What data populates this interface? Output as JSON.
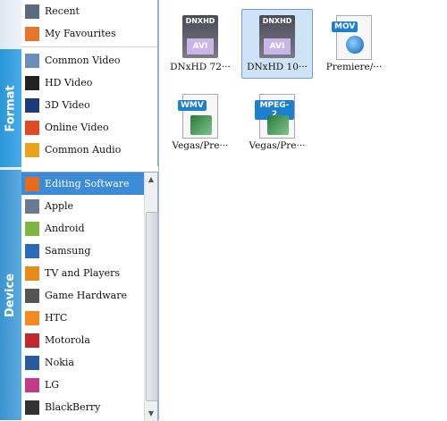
{
  "tabs": {
    "format": "Format",
    "device": "Device"
  },
  "format_list": [
    {
      "label": "Recent",
      "icon": "recent-icon",
      "color": "#5a6c80"
    },
    {
      "label": "My Favourites",
      "icon": "heart-icon",
      "color": "#e5762a"
    },
    {
      "label": "Common Video",
      "icon": "film-icon",
      "color": "#6b8fb8"
    },
    {
      "label": "HD Video",
      "icon": "hd-icon",
      "color": "#222"
    },
    {
      "label": "3D Video",
      "icon": "3d-icon",
      "color": "#1d3a7a"
    },
    {
      "label": "Online Video",
      "icon": "online-video-icon",
      "color": "#e04a20"
    },
    {
      "label": "Common Audio",
      "icon": "music-icon",
      "color": "#e6a41c"
    }
  ],
  "device_list": [
    {
      "label": "Editing Software",
      "icon": "editing-software-icon",
      "color": "#e56b1e",
      "selected": true
    },
    {
      "label": "Apple",
      "icon": "apple-device-icon",
      "color": "#6a7a90"
    },
    {
      "label": "Android",
      "icon": "android-icon",
      "color": "#7cb342"
    },
    {
      "label": "Samsung",
      "icon": "samsung-phone-icon",
      "color": "#2a6ab8"
    },
    {
      "label": "TV and Players",
      "icon": "tv-players-icon",
      "color": "#e88a1a"
    },
    {
      "label": "Game Hardware",
      "icon": "game-hardware-icon",
      "color": "#555"
    },
    {
      "label": "HTC",
      "icon": "htc-icon",
      "color": "#f08a22"
    },
    {
      "label": "Motorola",
      "icon": "motorola-icon",
      "color": "#c0282d"
    },
    {
      "label": "Nokia",
      "icon": "nokia-icon",
      "color": "#2a5a9e"
    },
    {
      "label": "LG",
      "icon": "lg-icon",
      "color": "#c43a8a"
    },
    {
      "label": "BlackBerry",
      "icon": "blackberry-icon",
      "color": "#333"
    }
  ],
  "formats": [
    {
      "caption": "DNxHD 72···",
      "badge": "DNXHD",
      "sub": "AVI",
      "icon": "dnxhd-avi-icon",
      "selected": false
    },
    {
      "caption": "DNxHD 10···",
      "badge": "DNXHD",
      "sub": "AVI",
      "icon": "dnxhd-avi-icon",
      "selected": true
    },
    {
      "caption": "Premiere/···",
      "badge": "MOV",
      "icon": "mov-quicktime-icon",
      "selected": false
    },
    {
      "caption": "Vegas/Pre···",
      "badge": "WMV",
      "icon": "wmv-film-icon",
      "selected": false
    },
    {
      "caption": "Vegas/Pre···",
      "badge": "MPEG-2",
      "icon": "mpeg2-film-icon",
      "selected": false
    }
  ],
  "colors": {
    "accent": "#3b8bd6",
    "tab": "#2a95d6",
    "selection_bg": "#cfe3f7"
  }
}
